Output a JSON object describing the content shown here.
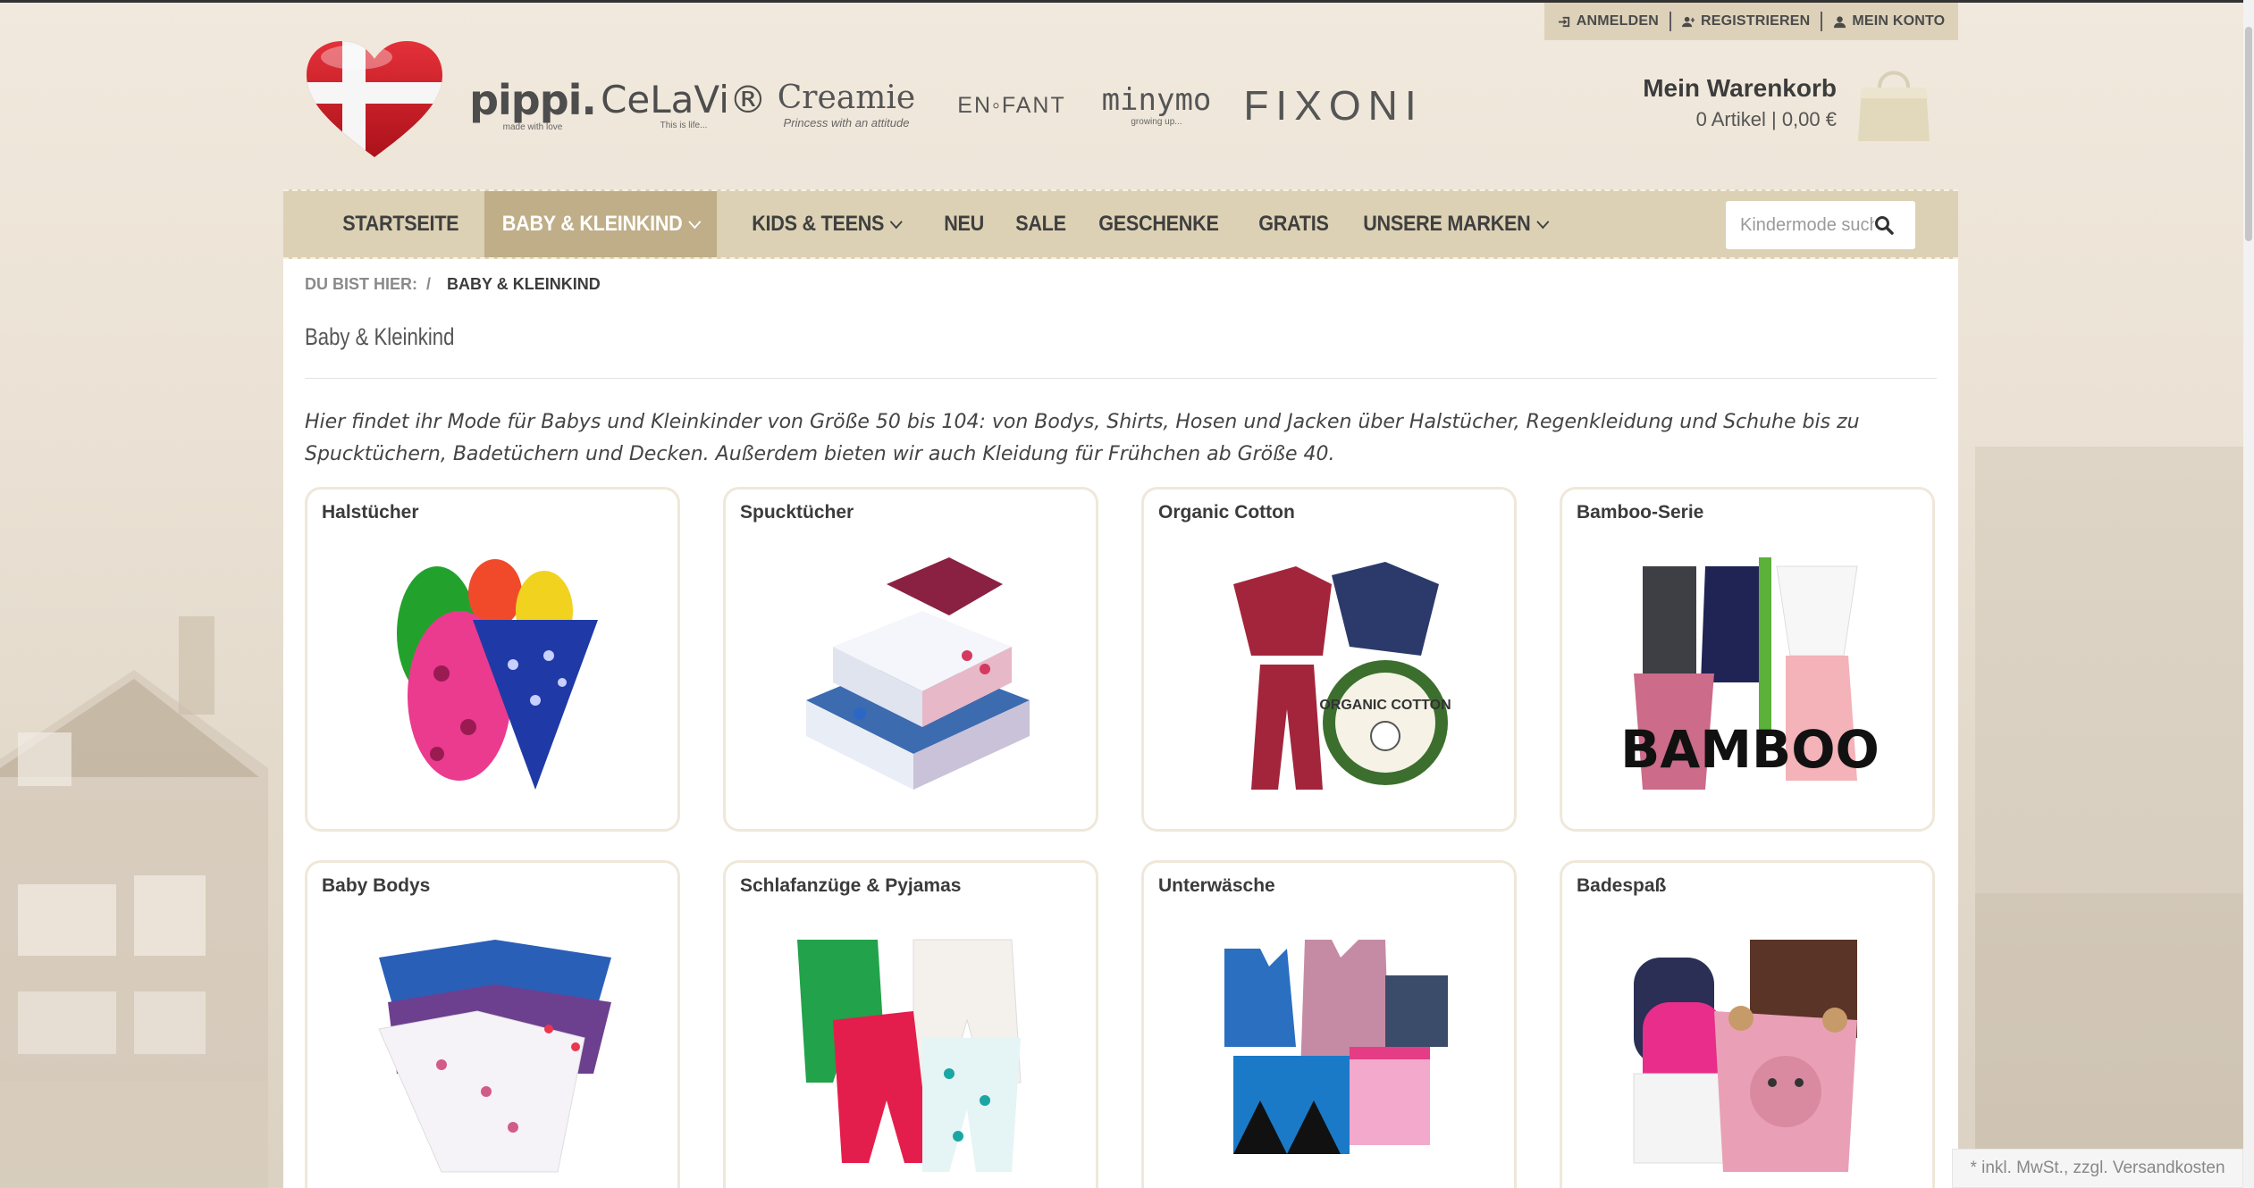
{
  "account": {
    "login": "ANMELDEN",
    "register": "REGISTRIEREN",
    "account": "MEIN KONTO"
  },
  "brands": [
    {
      "name": "pippi.",
      "tag": "made with love"
    },
    {
      "name": "CeLaVi®",
      "tag": "This is life..."
    },
    {
      "name": "Creamie",
      "tag": "Princess with an attitude"
    },
    {
      "name": "EN◦FANT",
      "tag": ""
    },
    {
      "name": "minymo",
      "tag": "growing up..."
    },
    {
      "name": "FIXONI",
      "tag": ""
    }
  ],
  "cart": {
    "title": "Mein Warenkorb",
    "info": "0 Artikel | 0,00 €"
  },
  "nav": {
    "items": [
      {
        "label": "STARTSEITE"
      },
      {
        "label": "BABY & KLEINKIND"
      },
      {
        "label": "KIDS & TEENS"
      },
      {
        "label": "NEU"
      },
      {
        "label": "SALE"
      },
      {
        "label": "GESCHENKE"
      },
      {
        "label": "GRATIS"
      },
      {
        "label": "UNSERE MARKEN"
      }
    ],
    "search_placeholder": "Kindermode suchen"
  },
  "breadcrumb": {
    "prefix": "DU BIST HIER:",
    "separator": "/",
    "current": "BABY & KLEINKIND"
  },
  "page": {
    "title": "Baby & Kleinkind",
    "intro": "Hier findet ihr Mode für Babys und Kleinkinder von Größe 50 bis 104: von Bodys, Shirts, Hosen und Jacken über Halstücher, Regenkleidung und Schuhe bis zu Spucktüchern, Badetüchern und Decken. Außerdem bieten wir auch Kleidung für Frühchen ab Größe 40."
  },
  "categories": [
    {
      "title": "Halstücher",
      "image": "bibs-image"
    },
    {
      "title": "Spucktücher",
      "image": "muslin-cloths-image"
    },
    {
      "title": "Organic Cotton",
      "image": "organic-cotton-image",
      "badge": "ORGANIC COTTON"
    },
    {
      "title": "Bamboo-Serie",
      "image": "bamboo-image",
      "badge": "BAMBOO"
    },
    {
      "title": "Baby Bodys",
      "image": "bodysuits-image"
    },
    {
      "title": "Schlafanzüge & Pyjamas",
      "image": "pajamas-image"
    },
    {
      "title": "Unterwäsche",
      "image": "underwear-image"
    },
    {
      "title": "Badespaß",
      "image": "bath-towels-image"
    }
  ],
  "footer": {
    "note": "* inkl. MwSt., zzgl. Versandkosten"
  },
  "colors": {
    "nav_bg": "#dcd1b4",
    "nav_active": "#bfae87",
    "account_bar": "#ddd2b9"
  }
}
